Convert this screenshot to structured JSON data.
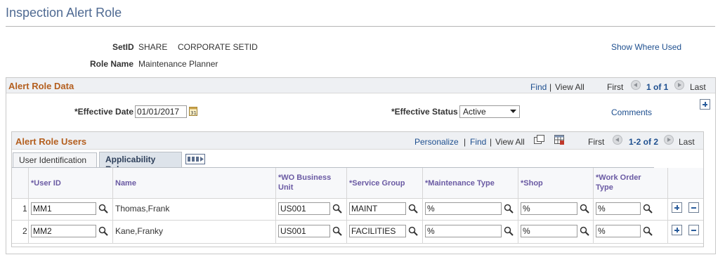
{
  "page": {
    "title": "Inspection Alert Role",
    "setid_label": "SetID",
    "setid_value": "SHARE",
    "setid_desc": "CORPORATE SETID",
    "role_label": "Role Name",
    "role_value": "Maintenance Planner",
    "show_where_used": "Show Where Used"
  },
  "alert_role_data": {
    "title": "Alert Role Data",
    "find": "Find",
    "view_all": "View All",
    "first": "First",
    "count": "1 of 1",
    "last": "Last",
    "effective_date_label": "*Effective Date",
    "effective_date_value": "01/01/2017",
    "effective_status_label": "*Effective Status",
    "effective_status_value": "Active",
    "comments": "Comments"
  },
  "alert_role_users": {
    "title": "Alert Role Users",
    "personalize": "Personalize",
    "find": "Find",
    "view_all": "View All",
    "first": "First",
    "count": "1-2 of 2",
    "last": "Last",
    "tabs": [
      "User Identification",
      "Applicability Rule"
    ],
    "columns": {
      "user_id": "*User ID",
      "name": "Name",
      "wo_bu_1": "*WO Business",
      "wo_bu_2": "Unit",
      "service_group": "*Service Group",
      "maintenance_type": "*Maintenance Type",
      "shop": "*Shop",
      "wo_type_1": "*Work Order",
      "wo_type_2": "Type"
    },
    "rows": [
      {
        "num": "1",
        "user_id": "MM1",
        "name": "Thomas,Frank",
        "wo_bu": "US001",
        "service_group": "MAINT",
        "maintenance_type": "%",
        "shop": "%",
        "wo_type": "%"
      },
      {
        "num": "2",
        "user_id": "MM2",
        "name": "Kane,Franky",
        "wo_bu": "US001",
        "service_group": "FACILITIES",
        "maintenance_type": "%",
        "shop": "%",
        "wo_type": "%"
      }
    ]
  }
}
